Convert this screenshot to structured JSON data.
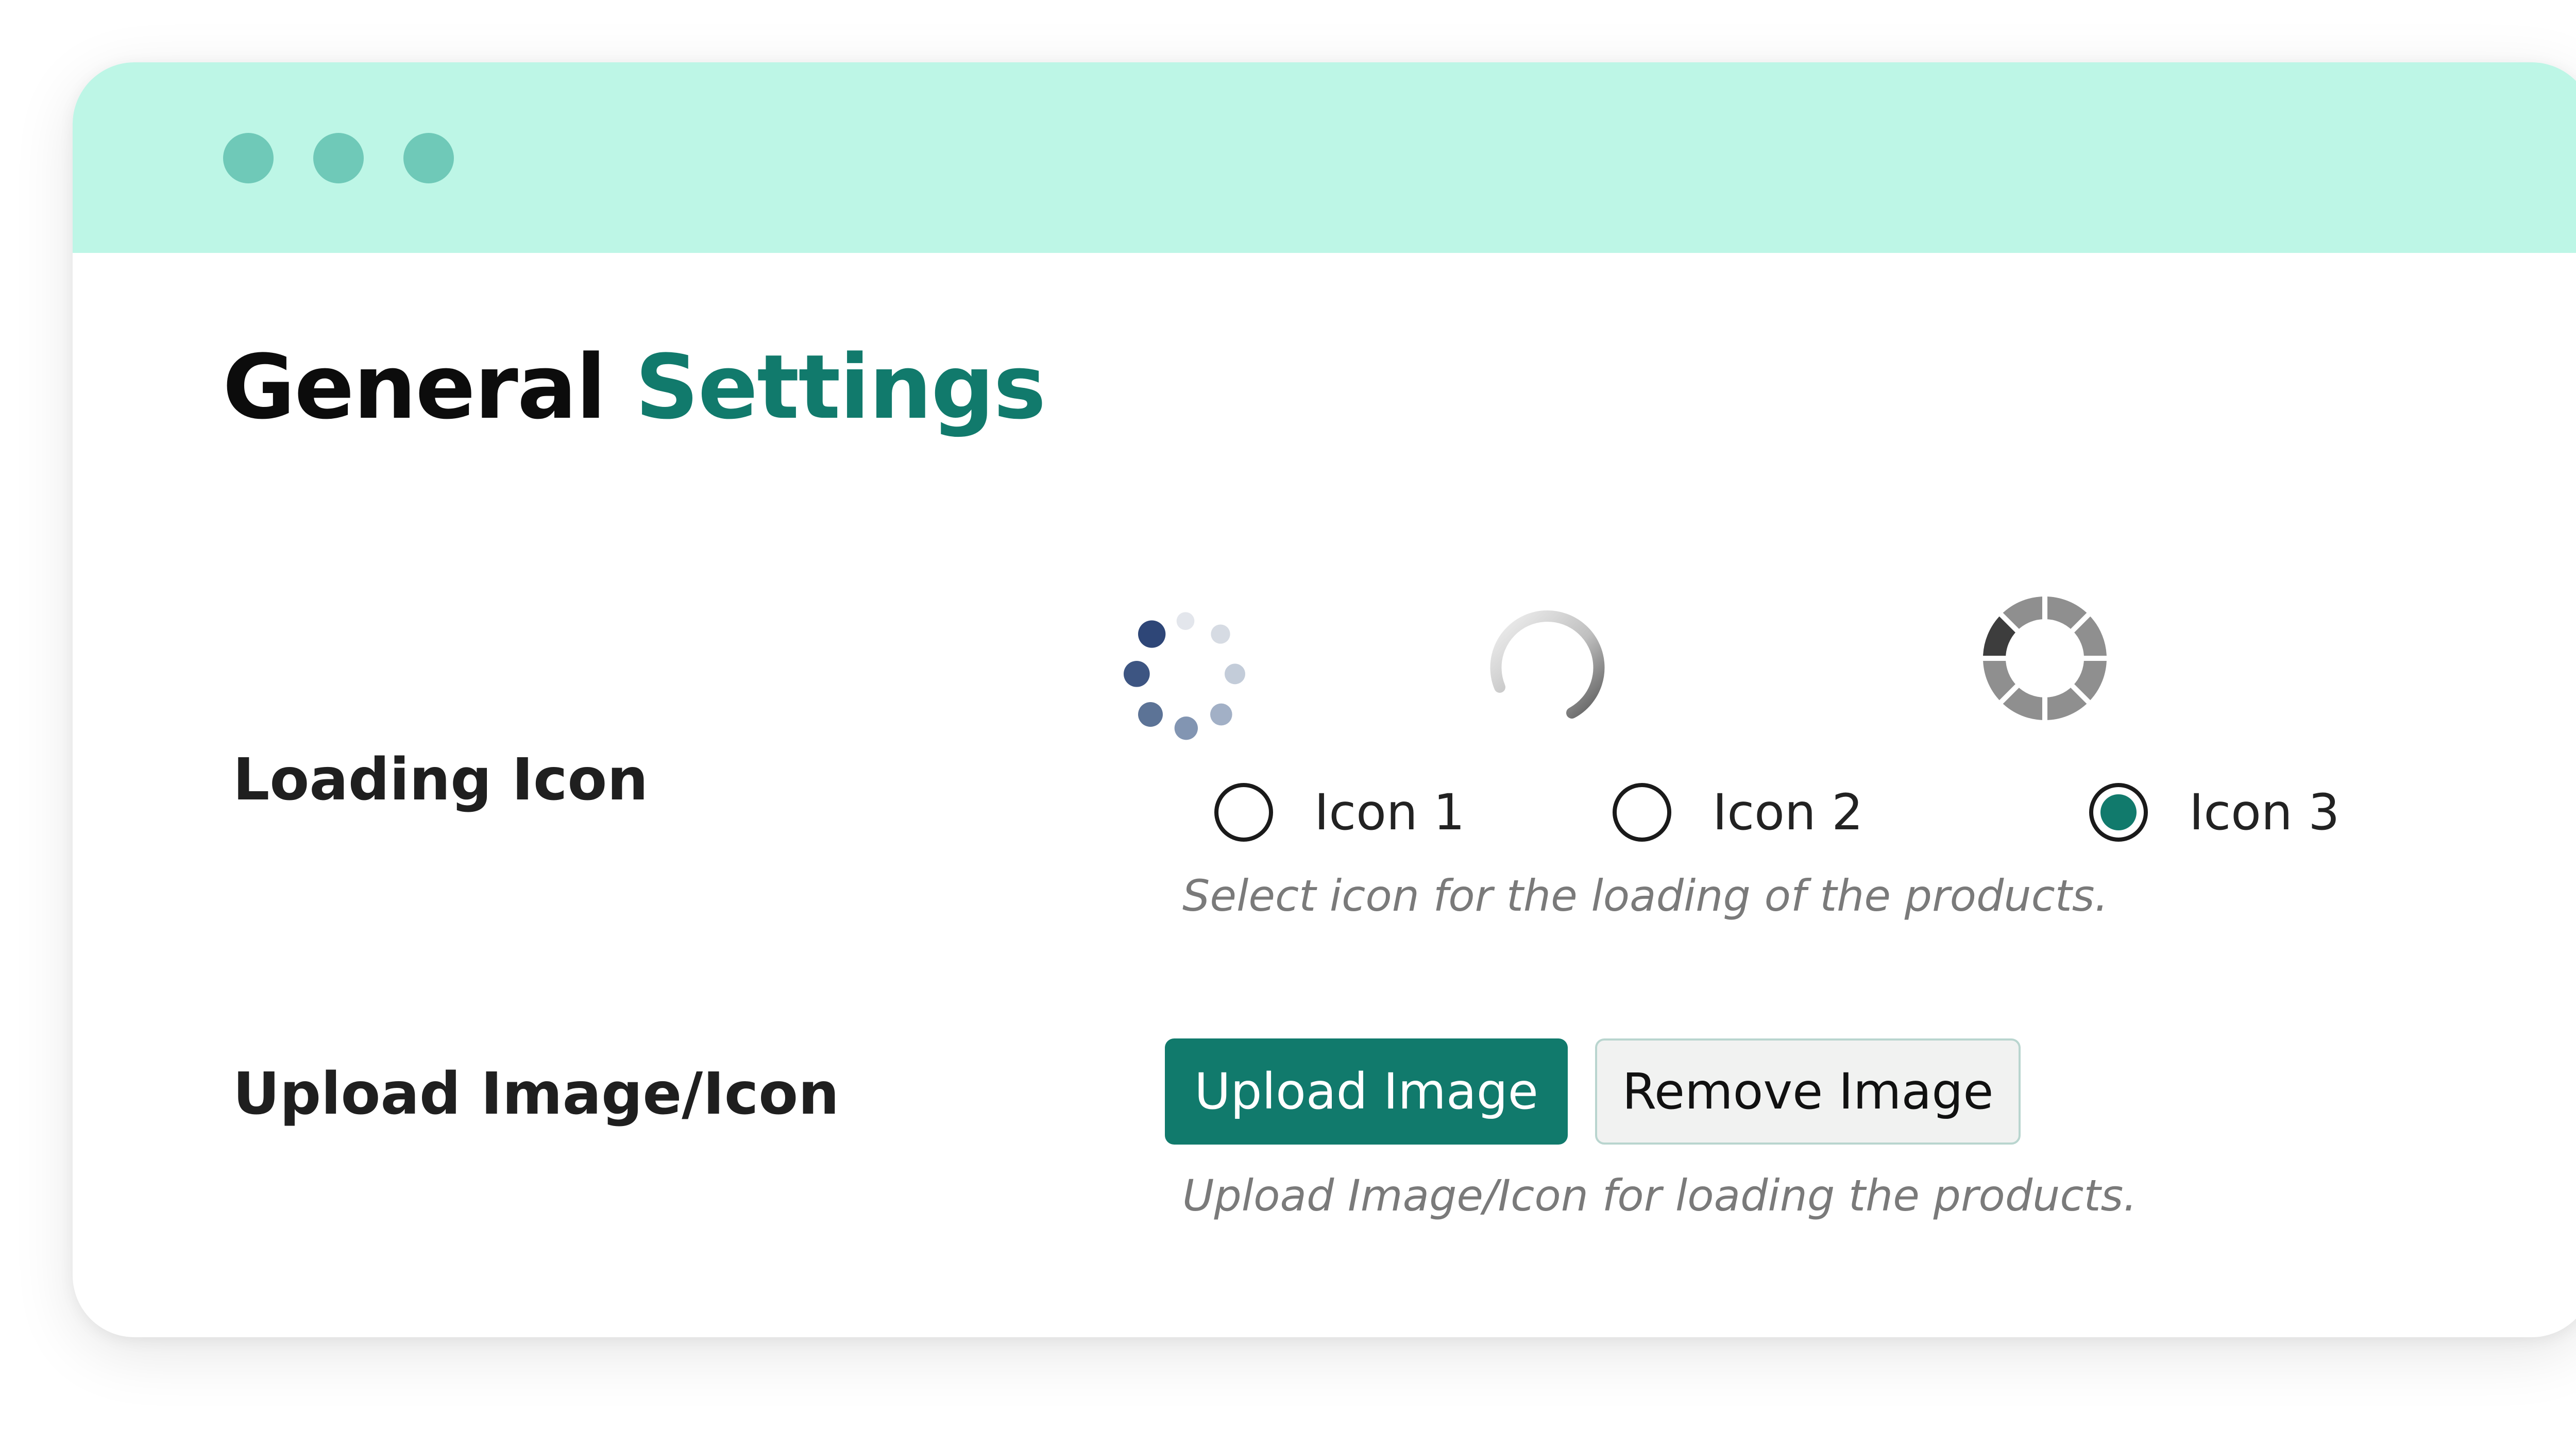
{
  "window": {
    "controls": [
      "close",
      "minimize",
      "maximize"
    ],
    "colors": {
      "titlebar": "#bdf6e6",
      "dot": "#6fc9b8",
      "accent": "#117a6c"
    }
  },
  "header": {
    "title_primary": "General",
    "title_accent": "Settings"
  },
  "loading_icon": {
    "label": "Loading Icon",
    "options": [
      {
        "label": "Icon 1",
        "preview": "dots-spinner-icon",
        "selected": false
      },
      {
        "label": "Icon 2",
        "preview": "ring-spinner-icon",
        "selected": false
      },
      {
        "label": "Icon 3",
        "preview": "segmented-ring-icon",
        "selected": true
      }
    ],
    "help": "Select icon for the loading of the products."
  },
  "upload": {
    "label": "Upload Image/Icon",
    "upload_button": "Upload Image",
    "remove_button": "Remove Image",
    "help": "Upload Image/Icon for loading the products."
  }
}
